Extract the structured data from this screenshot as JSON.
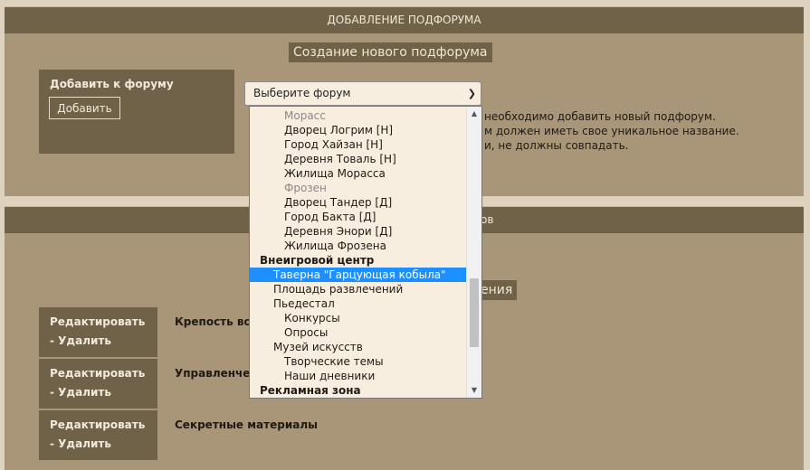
{
  "add_panel": {
    "header": "ДОБАВЛЕНИЕ ПОДФОРУМА",
    "subtitle": "Создание нового подфорума",
    "label": "Добавить к форуму",
    "button": "Добавить",
    "select_value": "Выберите форум",
    "help_lines": [
      "необходимо добавить новый подфорум.",
      "м должен иметь свое уникальное название.",
      "и, не должны совпадать."
    ]
  },
  "list_panel": {
    "header_fragment": "ов",
    "subtitle_fragment": "ения",
    "edit_label": "Редактировать",
    "delete_label": "- Удалить",
    "rows": [
      {
        "name": "Крепость во"
      },
      {
        "name": "Управленче"
      },
      {
        "name": "Секретные материалы"
      }
    ]
  },
  "dropdown": {
    "items": [
      {
        "text": "Морасс",
        "level": 2,
        "kind": "disabled"
      },
      {
        "text": "Дворец Логрим [Н]",
        "level": 2,
        "kind": "option"
      },
      {
        "text": "Город Хайзан [Н]",
        "level": 2,
        "kind": "option"
      },
      {
        "text": "Деревня Товаль [Н]",
        "level": 2,
        "kind": "option"
      },
      {
        "text": "Жилища Морасса",
        "level": 2,
        "kind": "option"
      },
      {
        "text": "Фрозен",
        "level": 2,
        "kind": "disabled"
      },
      {
        "text": "Дворец Тандер [Д]",
        "level": 2,
        "kind": "option"
      },
      {
        "text": "Город Бакта [Д]",
        "level": 2,
        "kind": "option"
      },
      {
        "text": "Деревня Энори [Д]",
        "level": 2,
        "kind": "option"
      },
      {
        "text": "Жилища Фрозена",
        "level": 2,
        "kind": "option"
      },
      {
        "text": "Внеигровой центр",
        "level": 0,
        "kind": "group"
      },
      {
        "text": "Таверна \"Гарцующая кобыла\"",
        "level": 1,
        "kind": "selected"
      },
      {
        "text": "Площадь развлечений",
        "level": 1,
        "kind": "option"
      },
      {
        "text": "Пьедестал",
        "level": 1,
        "kind": "option"
      },
      {
        "text": "Конкурсы",
        "level": 2,
        "kind": "option"
      },
      {
        "text": "Опросы",
        "level": 2,
        "kind": "option"
      },
      {
        "text": "Музей искусств",
        "level": 1,
        "kind": "option"
      },
      {
        "text": "Творческие темы",
        "level": 2,
        "kind": "option"
      },
      {
        "text": "Наши дневники",
        "level": 2,
        "kind": "option"
      },
      {
        "text": "Рекламная зона",
        "level": 0,
        "kind": "group"
      }
    ]
  }
}
